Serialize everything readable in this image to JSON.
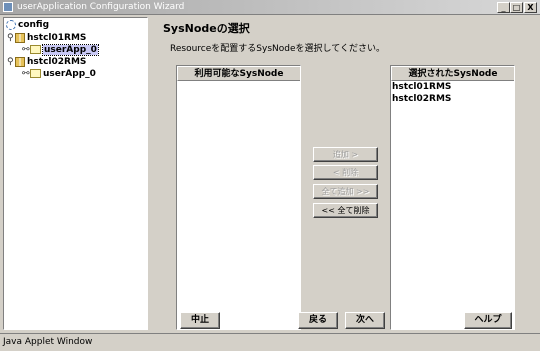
{
  "window": {
    "title": "userApplication Configuration Wizard",
    "minimize": "_",
    "maximize": "□",
    "close": "X"
  },
  "tree": {
    "root": "config",
    "hosts": [
      {
        "label": "hstcl01RMS",
        "app": "userApp_0",
        "selected": true
      },
      {
        "label": "hstcl02RMS",
        "app": "userApp_0",
        "selected": false
      }
    ]
  },
  "page": {
    "heading": "SysNodeの選択",
    "instruction": "Resourceを配置するSysNodeを選択してください。"
  },
  "available_list": {
    "header": "利用可能なSysNode",
    "items": []
  },
  "selected_list": {
    "header": "選択されたSysNode",
    "items": [
      "hstcl01RMS",
      "hstcl02RMS"
    ]
  },
  "transfer_buttons": {
    "add": "追加 >",
    "remove": "< 削除",
    "add_all": "全て追加 >>",
    "remove_all": "<< 全て削除"
  },
  "footer": {
    "cancel": "中止",
    "back": "戻る",
    "next": "次へ",
    "help": "ヘルプ"
  },
  "status": {
    "text": "Java Applet Window"
  }
}
